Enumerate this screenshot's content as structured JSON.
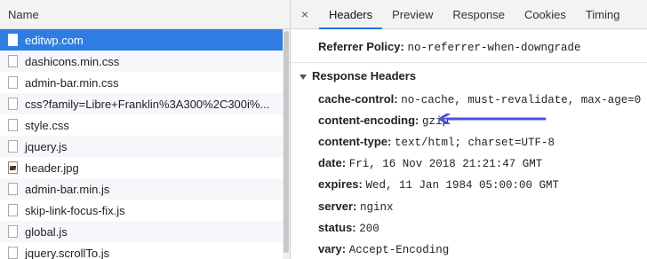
{
  "left_panel": {
    "header": "Name",
    "files": [
      {
        "name": "editwp.com",
        "icon": "file-icon",
        "selected": true
      },
      {
        "name": "dashicons.min.css",
        "icon": "file-icon"
      },
      {
        "name": "admin-bar.min.css",
        "icon": "file-icon"
      },
      {
        "name": "css?family=Libre+Franklin%3A300%2C300i%...",
        "icon": "file-icon"
      },
      {
        "name": "style.css",
        "icon": "file-icon"
      },
      {
        "name": "jquery.js",
        "icon": "file-icon"
      },
      {
        "name": "header.jpg",
        "icon": "image-file-icon"
      },
      {
        "name": "admin-bar.min.js",
        "icon": "file-icon"
      },
      {
        "name": "skip-link-focus-fix.js",
        "icon": "file-icon"
      },
      {
        "name": "global.js",
        "icon": "file-icon"
      },
      {
        "name": "jquery.scrollTo.js",
        "icon": "file-icon"
      }
    ]
  },
  "right_panel": {
    "close_icon": "×",
    "tabs": [
      {
        "label": "Headers",
        "active": true
      },
      {
        "label": "Preview"
      },
      {
        "label": "Response"
      },
      {
        "label": "Cookies"
      },
      {
        "label": "Timing"
      }
    ],
    "referrer_policy": {
      "key": "Referrer Policy:",
      "value": "no-referrer-when-downgrade"
    },
    "response_headers": {
      "title": "Response Headers",
      "rows": [
        {
          "key": "cache-control:",
          "value": "no-cache, must-revalidate, max-age=0"
        },
        {
          "key": "content-encoding:",
          "value": "gzip"
        },
        {
          "key": "content-type:",
          "value": "text/html; charset=UTF-8"
        },
        {
          "key": "date:",
          "value": "Fri, 16 Nov 2018 21:21:47 GMT"
        },
        {
          "key": "expires:",
          "value": "Wed, 11 Jan 1984 05:00:00 GMT"
        },
        {
          "key": "server:",
          "value": "nginx"
        },
        {
          "key": "status:",
          "value": "200"
        },
        {
          "key": "vary:",
          "value": "Accept-Encoding"
        }
      ]
    }
  },
  "colors": {
    "selected_row": "#2f7de2",
    "active_tab_underline": "#1a73e8",
    "annotation_arrow": "#4b4fe0"
  }
}
